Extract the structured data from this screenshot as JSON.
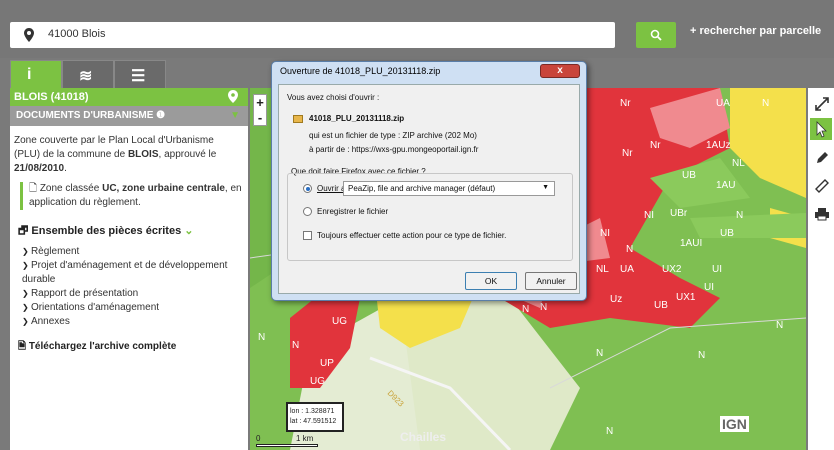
{
  "search": {
    "value": "41000 Blois",
    "button_icon": "search-icon",
    "parcel_link": "+ rechercher par parcelle"
  },
  "tabs": [
    {
      "label": "i",
      "icon": "info-icon",
      "active": true
    },
    {
      "label": "≋",
      "icon": "layers-icon",
      "active": false
    },
    {
      "label": "☰",
      "icon": "list-icon",
      "active": false
    }
  ],
  "panel": {
    "commune": "BLOIS (41018)",
    "section": "DOCUMENTS D'URBANISME ❶",
    "intro_1": "Zone couverte par le Plan Local d'Urbanisme (PLU) de la commune de ",
    "intro_commune": "BLOIS",
    "intro_2": ", approuvé le ",
    "intro_date": "21/08/2010",
    "intro_3": ".",
    "zone_1": "Zone classée ",
    "zone_code": "UC",
    "zone_name": ", zone urbaine centrale",
    "zone_2": ", en application du règlement.",
    "pieces_title": "Ensemble des pièces écrites",
    "pieces": [
      "Règlement",
      "Projet d'aménagement et de développement durable",
      "Rapport de présentation",
      "Orientations d'aménagement",
      "Annexes"
    ],
    "download": "Téléchargez l'archive complète"
  },
  "map": {
    "zoom_in": "+",
    "zoom_out": "-",
    "labels": [
      "Nr",
      "UA",
      "N",
      "1AUz",
      "Nr",
      "Nr",
      "UB",
      "NL",
      "1AU",
      "NI",
      "UBr",
      "N",
      "UB",
      "NI",
      "1AUI",
      "N",
      "NL",
      "UA",
      "UX2",
      "UI",
      "UI",
      "Uz",
      "UB",
      "UX1",
      "N",
      "UG",
      "N",
      "N",
      "UP",
      "UG",
      "N",
      "N",
      "N",
      "N",
      "N",
      "N"
    ],
    "coords": {
      "lon": "lon : 1.328871",
      "lat": "lat : 47.591512"
    },
    "scale": {
      "zero": "0",
      "dist": "1 km"
    },
    "place": "Chailles",
    "road": "D923",
    "attribution": "IGN"
  },
  "toolbar": [
    "expand-icon",
    "select-info-icon",
    "pencil-icon",
    "ruler-icon",
    "print-icon"
  ],
  "dialog": {
    "title": "Ouverture de 41018_PLU_20131118.zip",
    "close": "x",
    "chose": "Vous avez choisi d'ouvrir :",
    "filename": "41018_PLU_20131118.zip",
    "type_line": "qui est un fichier de type :  ZIP archive (202 Mo)",
    "from_line": "à partir de :  https://wxs-gpu.mongeoportail.ign.fr",
    "question": "Que doit faire Firefox avec ce fichier ?",
    "open_with": "Ouvrir avec",
    "app": "PeaZip, file and archive manager (défaut)",
    "save": "Enregistrer le fichier",
    "always": "Toujours effectuer cette action pour ce type de fichier.",
    "ok": "OK",
    "cancel": "Annuler"
  },
  "colors": {
    "accent": "#7cc242",
    "urban": "#e1343c",
    "au": "#f4e04b",
    "natural": "#7fbf52"
  }
}
